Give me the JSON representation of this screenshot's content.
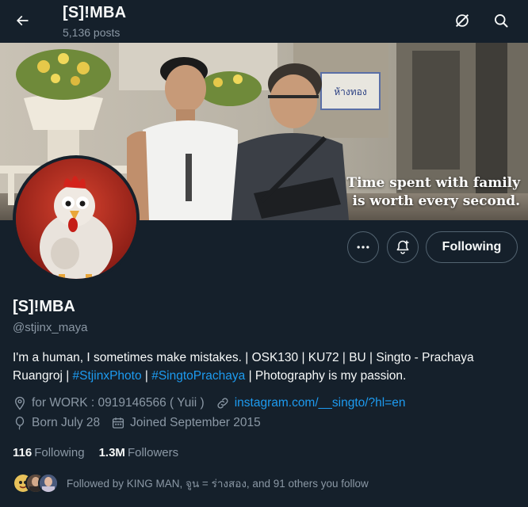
{
  "header": {
    "title": "[S]!MBA",
    "post_count": "5,136 posts"
  },
  "banner": {
    "caption_line1": "Time spent with family",
    "caption_line2": "is worth every second.",
    "shop_sign": "ห้างทอง"
  },
  "actions": {
    "following_label": "Following"
  },
  "profile": {
    "name": "[S]!MBA",
    "handle": "@stjinx_maya",
    "bio_text1": "I'm a human, I sometimes make mistakes. | OSK130 | KU72 | BU | Singto - Prachaya Ruangroj | ",
    "bio_tag1": "#StjinxPhoto",
    "bio_sep": " | ",
    "bio_tag2": "#SingtoPrachaya",
    "bio_text2": " | Photography is my passion.",
    "location": "for WORK : 0919146566 ( Yuii )",
    "link": "instagram.com/__singto/?hl=en",
    "birthday": "Born July 28",
    "joined": "Joined September 2015"
  },
  "stats": {
    "following_count": "116",
    "following_label": "Following",
    "followers_count": "1.3M",
    "followers_label": "Followers"
  },
  "followed_by": {
    "text": "Followed by KING MAN, จูน = ร่างสอง, and 91 others you follow"
  },
  "colors": {
    "background": "#15202b",
    "accent": "#1d9bf0",
    "secondary_text": "#8b98a5",
    "border": "#536471"
  },
  "icons": {
    "back": "arrow-left-icon",
    "search": "search-icon",
    "grok": "grok-icon",
    "more": "more-icon",
    "notify": "bell-plus-icon",
    "location": "location-pin-icon",
    "link": "link-icon",
    "birthday": "balloon-icon",
    "calendar": "calendar-icon"
  }
}
